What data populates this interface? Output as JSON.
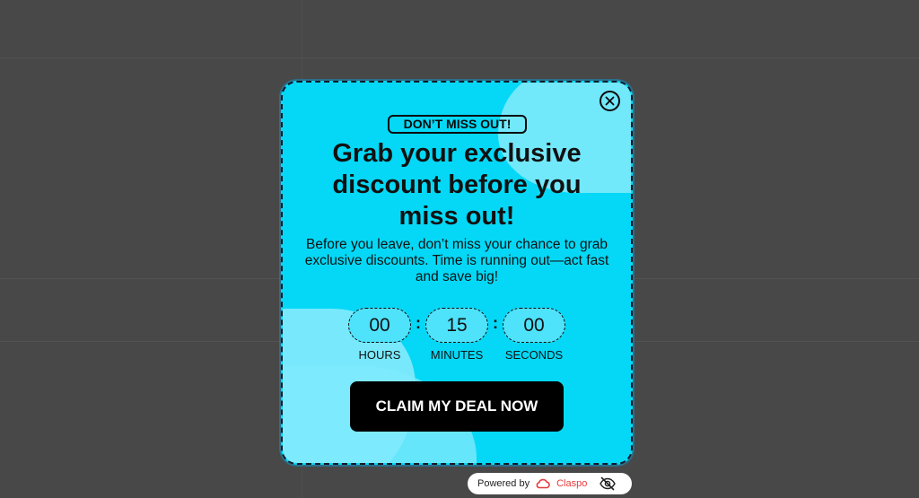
{
  "popup": {
    "badge": "DON’T MISS OUT!",
    "headline": "Grab your exclusive discount before you miss out!",
    "subtext": "Before you leave, don’t miss your chance to grab exclusive discounts. Time is running out—act fast and save big!",
    "close_icon": "close-icon",
    "colors": {
      "background": "#05d8f6",
      "accent_light": "#7eeafc",
      "button": "#000000",
      "button_text": "#ffffff"
    },
    "countdown": {
      "hours": "00",
      "minutes": "15",
      "seconds": "00",
      "separator": ":",
      "hours_label": "HOURS",
      "minutes_label": "MINUTES",
      "seconds_label": "SECONDS"
    },
    "cta_label": "CLAIM MY DEAL NOW"
  },
  "powered_by": {
    "prefix": "Powered by",
    "brand": "Claspo",
    "brand_icon": "claspo-cloud-icon",
    "hide_icon": "eye-off-icon"
  }
}
